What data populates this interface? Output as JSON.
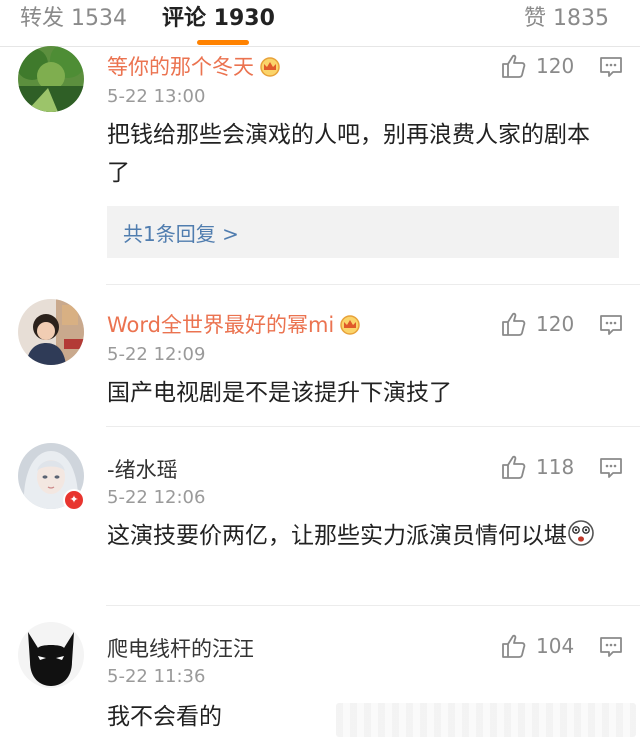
{
  "tabs": {
    "repost": "转发 1534",
    "comments": "评论 1930",
    "likes": "赞 1835"
  },
  "accent_color": "#ff8200",
  "vip_name_color": "#eb7350",
  "comments": [
    {
      "user": "等你的那个冬天",
      "vip": true,
      "time": "5-22 13:00",
      "likes": "120",
      "text": "把钱给那些会演戏的人吧，别再浪费人家的剧本了",
      "replies": "共1条回复 >",
      "avatar_icon": "forest-avatar"
    },
    {
      "user": "Word全世界最好的幂mi",
      "vip": true,
      "time": "5-22 12:09",
      "likes": "120",
      "text": "国产电视剧是不是该提升下演技了",
      "avatar_icon": "girl-photo-avatar"
    },
    {
      "user": "-绪水瑶",
      "vip": false,
      "time": "5-22 12:06",
      "likes": "118",
      "text": "这演技要价两亿，让那些实力派演员情何以堪",
      "emoji": "dizzy-face-emoji",
      "avatar_icon": "anime-avatar",
      "avatar_badge": "verified-badge"
    },
    {
      "user": "爬电线杆的汪汪",
      "vip": false,
      "time": "5-22 11:36",
      "likes": "104",
      "text": "我不会看的",
      "avatar_icon": "batman-avatar"
    }
  ]
}
